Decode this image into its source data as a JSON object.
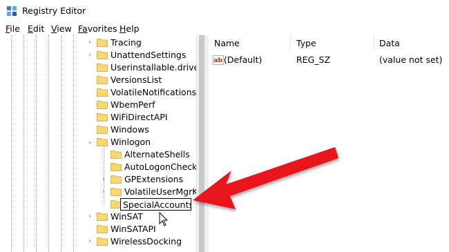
{
  "window": {
    "title": "Registry Editor"
  },
  "menu": [
    {
      "key": "F",
      "rest": "ile"
    },
    {
      "key": "E",
      "rest": "dit"
    },
    {
      "key": "V",
      "rest": "iew"
    },
    {
      "key": "Fa",
      "rest": "vorites"
    },
    {
      "key": "H",
      "rest": "elp"
    }
  ],
  "tree": [
    {
      "label": "Tracing",
      "expander": "›"
    },
    {
      "label": "UnattendSettings",
      "expander": "›"
    },
    {
      "label": "Userinstallable.drivers",
      "expander": ""
    },
    {
      "label": "VersionsList",
      "expander": ""
    },
    {
      "label": "VolatileNotifications",
      "expander": ""
    },
    {
      "label": "WbemPerf",
      "expander": ""
    },
    {
      "label": "WiFiDirectAPI",
      "expander": ""
    },
    {
      "label": "Windows",
      "expander": ""
    },
    {
      "label": "Winlogon",
      "expander": "⌄"
    },
    {
      "label": "AlternateShells",
      "expander": ""
    },
    {
      "label": "AutoLogonChecke",
      "expander": ""
    },
    {
      "label": "GPExtensions",
      "expander": "›"
    },
    {
      "label": "VolatileUserMgrKey",
      "expander": "›"
    },
    {
      "label": "SpecialAccounts",
      "expander": ""
    },
    {
      "label": "WinSAT",
      "expander": "›"
    },
    {
      "label": "WinSATAPI",
      "expander": ""
    },
    {
      "label": "WirelessDocking",
      "expander": "›"
    }
  ],
  "edit_value": "SpecialAccounts",
  "list": {
    "columns": [
      "Name",
      "Type",
      "Data"
    ],
    "rows": [
      {
        "name": "(Default)",
        "type": "REG_SZ",
        "data": "(value not set)",
        "icon": "string-value-icon"
      }
    ]
  },
  "colors": {
    "arrow": "#e8121b",
    "folder": "#f7d774",
    "folder_edge": "#d9b44a"
  }
}
